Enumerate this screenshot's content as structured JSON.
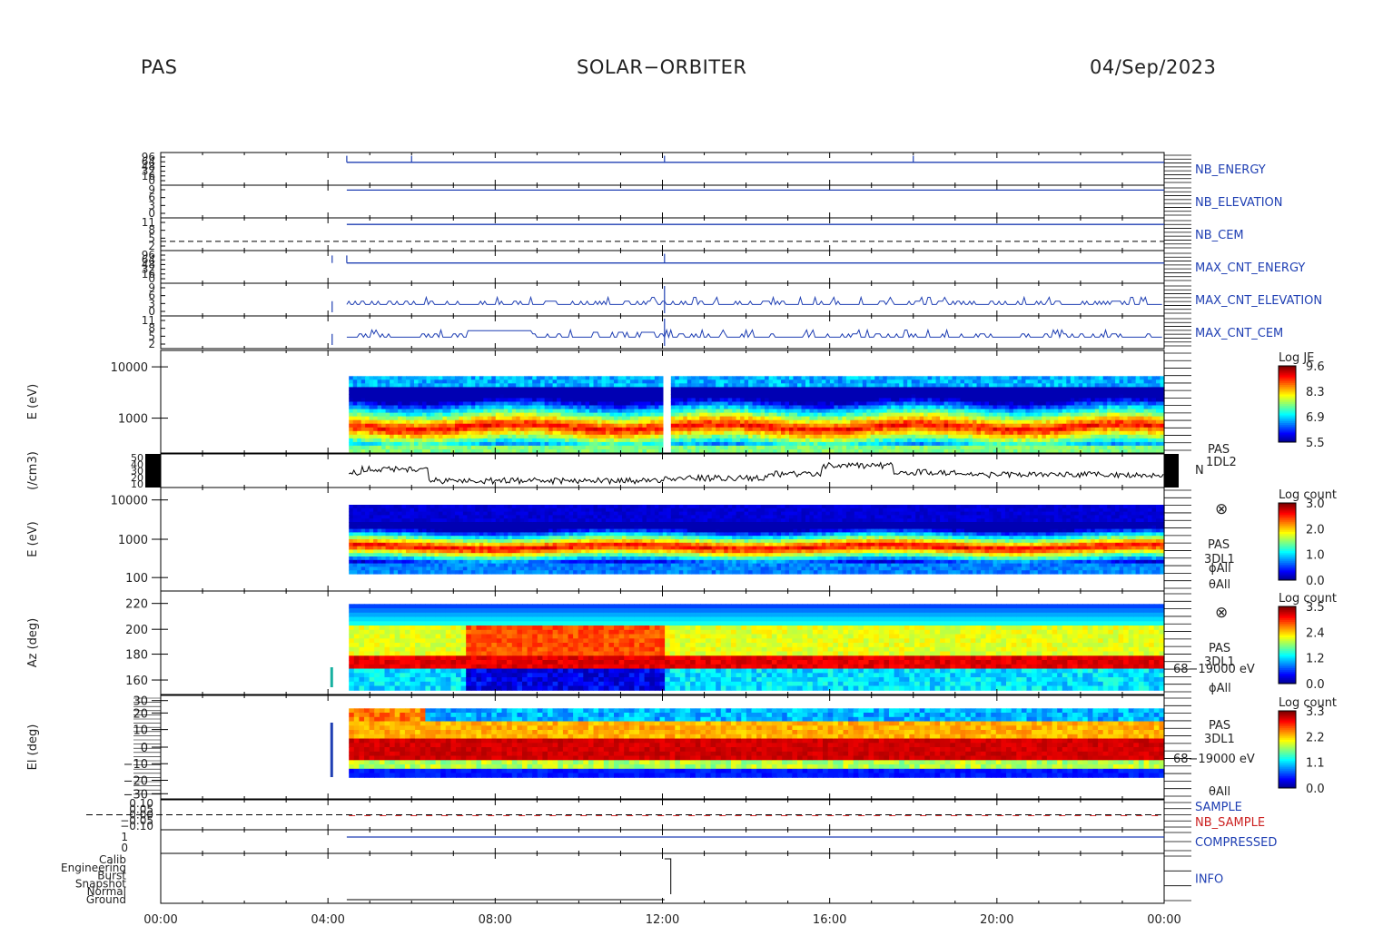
{
  "header": {
    "left": "PAS",
    "center": "SOLAR−ORBITER",
    "right": "04/Sep/2023"
  },
  "chart_data": {
    "type": "line",
    "x_axis": {
      "ticks": [
        "00:00",
        "04:00",
        "08:00",
        "12:00",
        "16:00",
        "20:00",
        "00:00"
      ]
    },
    "panels": [
      {
        "id": "nb_energy",
        "right_label": "NB_ENERGY",
        "right_color": "#1f3fb3",
        "tick_labels": [
          "96",
          "64",
          "48",
          "32",
          "16",
          "0"
        ]
      },
      {
        "id": "nb_elevation",
        "right_label": "NB_ELEVATION",
        "right_color": "#1f3fb3",
        "tick_labels": [
          "9",
          "6",
          "3",
          "0"
        ]
      },
      {
        "id": "nb_cem",
        "right_label": "NB_CEM",
        "right_color": "#1f3fb3",
        "tick_labels": [
          "11",
          "8",
          "5",
          "2"
        ]
      },
      {
        "id": "max_cnt_energy",
        "right_label": "MAX_CNT_ENERGY",
        "right_color": "#1f3fb3",
        "tick_labels": [
          "96",
          "64",
          "48",
          "32",
          "16",
          "0"
        ]
      },
      {
        "id": "max_cnt_elevation",
        "right_label": "MAX_CNT_ELEVATION",
        "right_color": "#1f3fb3",
        "tick_labels": [
          "9",
          "6",
          "3",
          "0"
        ]
      },
      {
        "id": "max_cnt_cem",
        "right_label": "MAX_CNT_CEM",
        "right_color": "#1f3fb3",
        "tick_labels": [
          "11",
          "8",
          "5",
          "2"
        ]
      },
      {
        "id": "energy_je",
        "ylabel": "E (eV)",
        "y_ticks": [
          "10000",
          "1000"
        ],
        "colorbar": {
          "title": "Log JE",
          "ticks": [
            "9.6",
            "8.3",
            "6.9",
            "5.5"
          ]
        }
      },
      {
        "id": "density",
        "ylabel": "(/cm3)",
        "tick_labels": [
          "50",
          "40",
          "30",
          "20",
          "10"
        ],
        "right_labels": [
          "PAS",
          "1DL2",
          "N"
        ]
      },
      {
        "id": "energy_count",
        "ylabel": "E (eV)",
        "y_ticks": [
          "10000",
          "1000",
          "100"
        ],
        "colorbar": {
          "title": "Log count",
          "ticks": [
            "3.0",
            "2.0",
            "1.0",
            "0.0"
          ]
        },
        "right_labels": [
          "⊗",
          "PAS",
          "3DL1",
          "ϕAll",
          "θAll"
        ]
      },
      {
        "id": "azimuth",
        "ylabel": "Az (deg)",
        "y_ticks": [
          "220",
          "200",
          "180",
          "160"
        ],
        "colorbar": {
          "title": "Log count",
          "ticks": [
            "3.5",
            "2.4",
            "1.2",
            "0.0"
          ]
        },
        "right_labels": [
          "⊗",
          "PAS",
          "3DL1",
          "68−19000 eV",
          "ϕAll"
        ]
      },
      {
        "id": "elevation",
        "ylabel": "El (deg)",
        "y_ticks": [
          "30",
          "20",
          "10",
          "0",
          "−10",
          "−20",
          "−30"
        ],
        "colorbar": {
          "title": "Log count",
          "ticks": [
            "3.3",
            "2.2",
            "1.1",
            "0.0"
          ]
        },
        "right_labels": [
          "PAS",
          "3DL1",
          "68−19000 eV",
          "θAll"
        ]
      },
      {
        "id": "sample",
        "tick_labels": [
          "0.10",
          "0.05",
          "0.00",
          "−0.05",
          "−0.10"
        ],
        "right_labels": [
          "SAMPLE",
          "NB_SAMPLE"
        ],
        "right_colors": [
          "#1f3fb3",
          "#cc2222"
        ]
      },
      {
        "id": "compressed",
        "tick_labels": [
          "1",
          "0"
        ],
        "right_label": "COMPRESSED",
        "right_color": "#1f3fb3"
      },
      {
        "id": "info",
        "tick_labels": [
          "Calib",
          "Engineering",
          "Burst",
          "Snapshot",
          "Normal",
          "Ground"
        ],
        "right_label": "INFO",
        "right_color": "#1f3fb3"
      }
    ]
  }
}
